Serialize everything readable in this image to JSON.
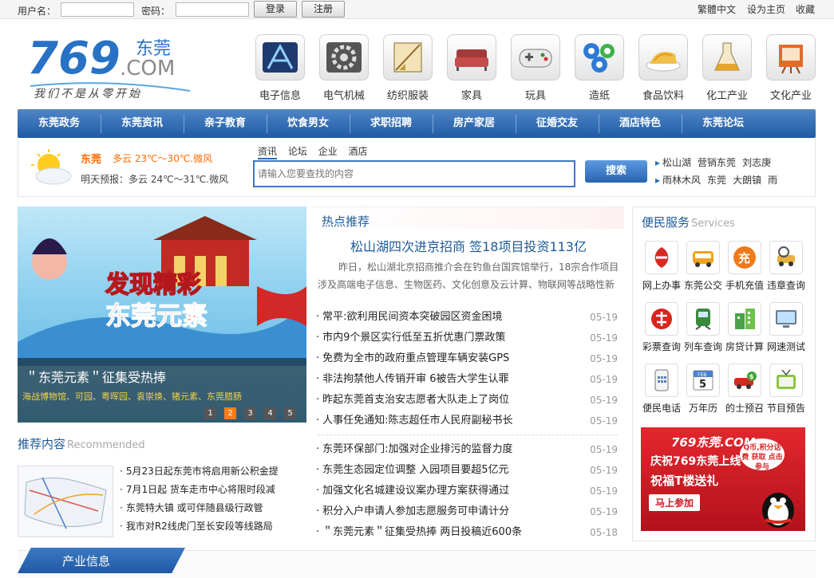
{
  "topbar": {
    "username_label": "用户名：",
    "password_label": "密码：",
    "login_label": "登录",
    "register_label": "注册",
    "right_links": [
      "繁體中文",
      "设为主页",
      "收藏"
    ]
  },
  "logo": {
    "brand": "769",
    "city": "东莞",
    "domain": ".COM",
    "slogan": "我们不是从零开始"
  },
  "categories": [
    {
      "label": "电子信息",
      "icon": "electronics-icon"
    },
    {
      "label": "电气机械",
      "icon": "machinery-icon"
    },
    {
      "label": "纺织服装",
      "icon": "textile-icon"
    },
    {
      "label": "家具",
      "icon": "sofa-icon"
    },
    {
      "label": "玩具",
      "icon": "gamepad-icon"
    },
    {
      "label": "造纸",
      "icon": "paper-icon"
    },
    {
      "label": "食品饮料",
      "icon": "food-icon"
    },
    {
      "label": "化工产业",
      "icon": "chemistry-icon"
    },
    {
      "label": "文化产业",
      "icon": "culture-icon"
    }
  ],
  "nav": [
    "东莞政务",
    "东莞资讯",
    "亲子教育",
    "饮食男女",
    "求职招聘",
    "房产家居",
    "征婚交友",
    "酒店特色",
    "东莞论坛"
  ],
  "weather": {
    "city": "东莞",
    "today": "多云 23℃～30℃.微风",
    "tomorrow": "明天预报：多云 24℃～31℃.微风"
  },
  "search": {
    "tabs": [
      "资讯",
      "论坛",
      "企业",
      "酒店"
    ],
    "placeholder": "请输入您要查找的内容",
    "button_label": "搜索",
    "hot_row1": [
      "松山湖",
      "营销东莞",
      "刘志庚"
    ],
    "hot_row2": [
      "雨林木风",
      "东莞",
      "大朗镇",
      "雨"
    ]
  },
  "banner": {
    "caption_title": "＂东莞元素＂征集受热捧",
    "caption_sub": "海战博物馆、可园、粤晖园、袁崇焕、猪元素、东莞腊肠",
    "art_title_1": "发现精彩",
    "art_title_2": "东莞元素",
    "pages": [
      "1",
      "2",
      "3",
      "4",
      "5"
    ],
    "active_page": "2"
  },
  "recommended": {
    "title": "推荐内容",
    "title_en": "Recommended",
    "items": [
      "5月23日起东莞市将启用新公积金提",
      "7月1日起 货车走市中心将限时段减",
      "东莞特大镇 或可伴随县级行政管",
      "我市对R2线虎门至长安段等线路局"
    ]
  },
  "hot_news": {
    "title": "热点推荐",
    "headline": "松山湖四次进京招商  签18项目投资113亿",
    "summary": "昨日，松山湖北京招商推介会在钓鱼台国宾馆举行，18宗合作项目涉及高端电子信息、生物医药、文化创意及云计算、物联网等战略性新",
    "list1": [
      {
        "title": "常平:欲利用民间资本突破园区资金困境",
        "date": "05-19"
      },
      {
        "title": "市内9个景区实行低至五折优惠门票政策",
        "date": "05-19"
      },
      {
        "title": "免费为全市的政府重点管理车辆安装GPS",
        "date": "05-19"
      },
      {
        "title": "非法拘禁他人传销开审   6被告大学生认罪",
        "date": "05-19"
      },
      {
        "title": "昨起东莞首支治安志愿者大队走上了岗位",
        "date": "05-19"
      },
      {
        "title": "人事任免通知:陈志超任市人民府副秘书长",
        "date": "05-19"
      }
    ],
    "list2": [
      {
        "title": "东莞环保部门:加强对企业排污的监督力度",
        "date": "05-19"
      },
      {
        "title": "东莞生态园定位调整  入园项目要超5亿元",
        "date": "05-19"
      },
      {
        "title": "加强文化名城建设议案办理方案获得通过",
        "date": "05-19"
      },
      {
        "title": "积分入户申请人参加志愿服务可申请计分",
        "date": "05-19"
      },
      {
        "title": "＂东莞元素＂征集受热捧  两日投稿近600条",
        "date": "05-18"
      }
    ]
  },
  "services": {
    "title": "便民服务",
    "title_en": "Services",
    "items": [
      {
        "label": "网上办事",
        "icon": "government-icon"
      },
      {
        "label": "东莞公交",
        "icon": "bus-icon"
      },
      {
        "label": "手机充值",
        "icon": "recharge-icon"
      },
      {
        "label": "违章查询",
        "icon": "car-search-icon"
      },
      {
        "label": "彩票查询",
        "icon": "lottery-icon"
      },
      {
        "label": "列车查询",
        "icon": "train-icon"
      },
      {
        "label": "房贷计算",
        "icon": "calculator-icon"
      },
      {
        "label": "网速测试",
        "icon": "monitor-icon"
      },
      {
        "label": "便民电话",
        "icon": "phone-icon"
      },
      {
        "label": "万年历",
        "icon": "calendar-icon"
      },
      {
        "label": "的士预召",
        "icon": "taxi-icon"
      },
      {
        "label": "节目预告",
        "icon": "tv-icon"
      }
    ],
    "calendar_month": "FEB",
    "calendar_day": "5"
  },
  "promo": {
    "logo": "769东莞.COM",
    "line1": "庆祝769东莞上线",
    "line2": "祝福T楼送礼",
    "bubble": "Q币,积分话费 获取 点击参与",
    "join_label": "马上参加"
  },
  "industry": {
    "title": "产业信息"
  },
  "colors": {
    "nav_blue": "#2a63b0",
    "link_blue": "#1d5a99",
    "weather_orange": "#ff6a00"
  }
}
